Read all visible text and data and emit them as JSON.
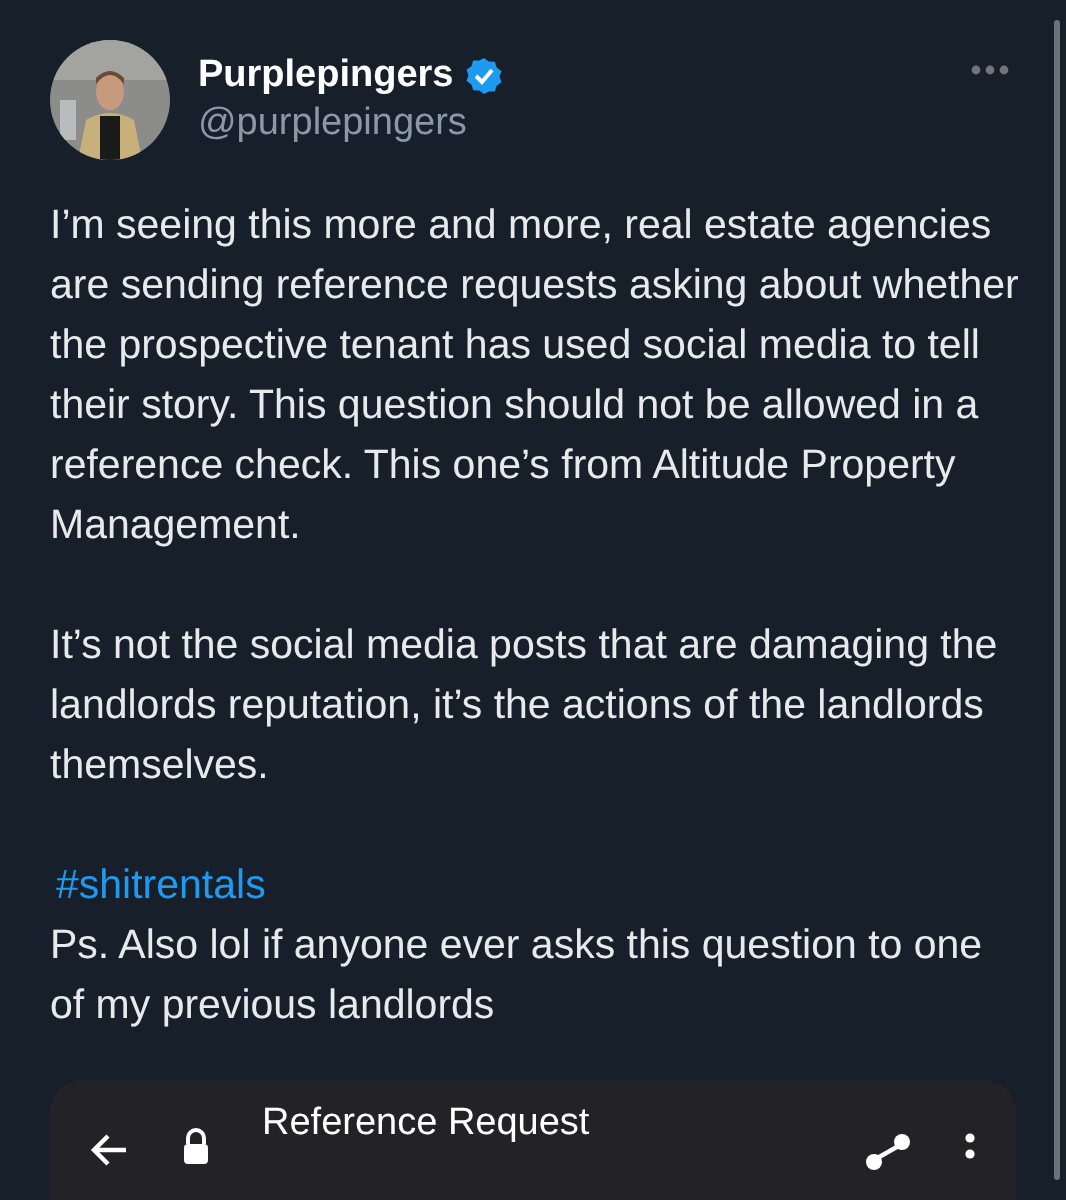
{
  "author": {
    "name": "Purplepingers",
    "verified": true,
    "handle": "@purplepingers"
  },
  "blocks": [
    {
      "kind": "paragraph",
      "text": "I’m seeing this more and more, real estate agencies are sending reference requests asking about whether the prospective tenant has used social media to tell their story. This question should not be allowed in a reference check. This one’s from Altitude Property Management."
    },
    {
      "kind": "paragraph",
      "text": "It’s not the social media posts that are damaging the landlords reputation, it’s the actions of the landlords themselves."
    },
    {
      "kind": "hashtag",
      "text": "#shitrentals"
    },
    {
      "kind": "line",
      "text": "Ps. Also lol if anyone ever asks this question to one of my previous landlords"
    }
  ],
  "embed": {
    "title": "Reference Request"
  }
}
